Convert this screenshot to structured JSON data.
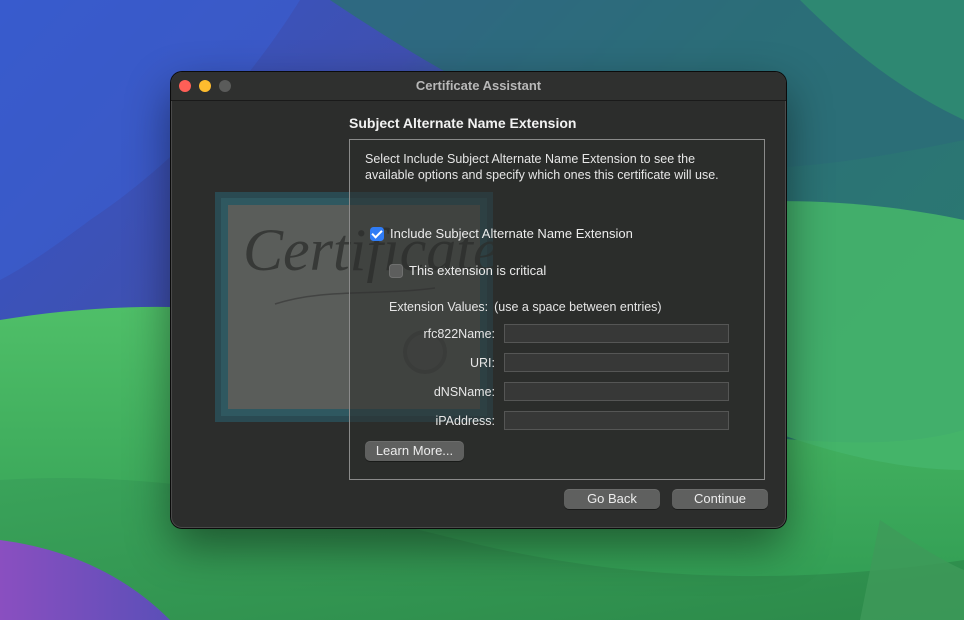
{
  "window": {
    "title": "Certificate Assistant"
  },
  "illustration": {
    "script_text": "Certificate"
  },
  "panel": {
    "title": "Subject Alternate Name Extension",
    "description": "Select Include Subject Alternate Name Extension to see the available options and specify which ones this certificate will use.",
    "include_checkbox": {
      "label": "Include Subject Alternate Name Extension",
      "checked": true
    },
    "critical_checkbox": {
      "label": "This extension is critical",
      "checked": false
    },
    "values_header": "Extension Values:",
    "values_hint": "(use a space between entries)",
    "fields": [
      {
        "label": "rfc822Name:",
        "value": ""
      },
      {
        "label": "URI:",
        "value": ""
      },
      {
        "label": "dNSName:",
        "value": ""
      },
      {
        "label": "iPAddress:",
        "value": ""
      }
    ],
    "learn_more_label": "Learn More..."
  },
  "footer": {
    "go_back_label": "Go Back",
    "continue_label": "Continue"
  },
  "colors": {
    "accent": "#2f7cf6",
    "window_bg": "#2c2d2c",
    "close": "#ff5f57",
    "minimize": "#febc2e"
  }
}
